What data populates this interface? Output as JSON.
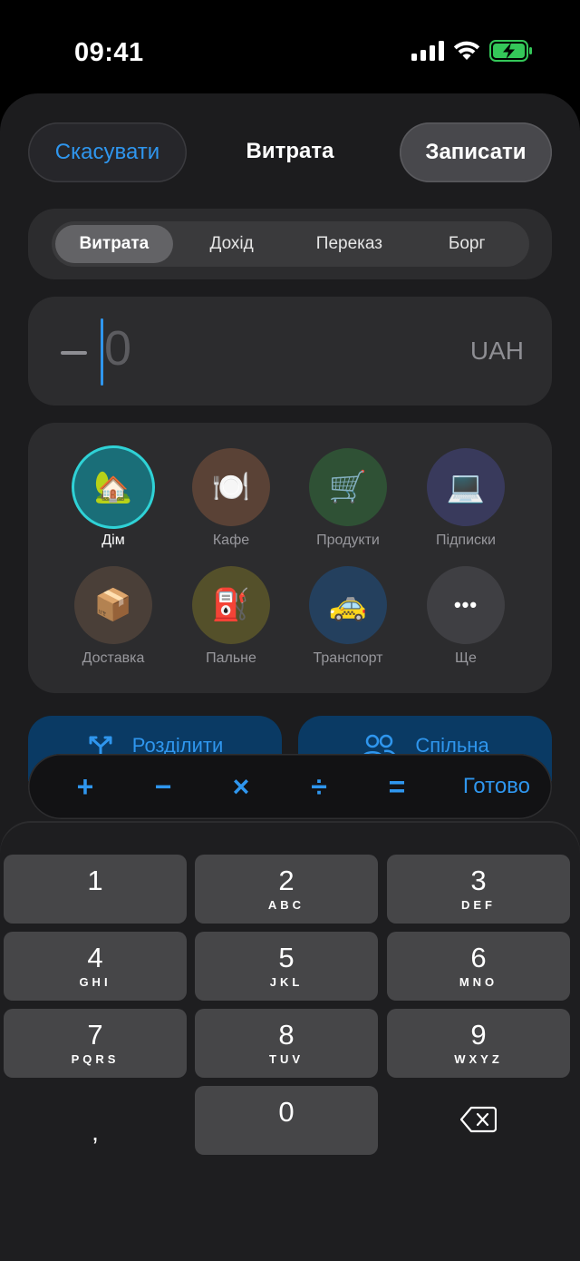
{
  "status": {
    "time": "09:41"
  },
  "nav": {
    "cancel": "Скасувати",
    "title": "Витрата",
    "save": "Записати"
  },
  "tabs": [
    "Витрата",
    "Дохід",
    "Переказ",
    "Борг"
  ],
  "amount": {
    "value": "0",
    "currency": "UAH"
  },
  "categories": [
    {
      "label": "Дім",
      "icon": "🏡",
      "icon_name": "house-icon",
      "color": "#1a6e78"
    },
    {
      "label": "Кафе",
      "icon": "🍽️",
      "icon_name": "plate-icon",
      "color": "#5a4236"
    },
    {
      "label": "Продукти",
      "icon": "🛒",
      "icon_name": "cart-icon",
      "color": "#2f5135"
    },
    {
      "label": "Підписки",
      "icon": "💻",
      "icon_name": "laptop-icon",
      "color": "#393a5c"
    },
    {
      "label": "Доставка",
      "icon": "📦",
      "icon_name": "package-icon",
      "color": "#4a3f38"
    },
    {
      "label": "Пальне",
      "icon": "⛽",
      "icon_name": "fuel-pump-icon",
      "color": "#54502a"
    },
    {
      "label": "Транспорт",
      "icon": "🚕",
      "icon_name": "taxi-icon",
      "color": "#24405e"
    },
    {
      "label": "Ще",
      "icon": "•••",
      "icon_name": "more-icon",
      "color": "#3f3f43"
    }
  ],
  "actions": {
    "split": "Розділити",
    "shared": "Спільна"
  },
  "calc": {
    "ops": [
      "+",
      "−",
      "×",
      "÷",
      "="
    ],
    "done": "Готово"
  },
  "keys": [
    {
      "digit": "1",
      "letters": ""
    },
    {
      "digit": "2",
      "letters": "ABC"
    },
    {
      "digit": "3",
      "letters": "DEF"
    },
    {
      "digit": "4",
      "letters": "GHI"
    },
    {
      "digit": "5",
      "letters": "JKL"
    },
    {
      "digit": "6",
      "letters": "MNO"
    },
    {
      "digit": "7",
      "letters": "PQRS"
    },
    {
      "digit": "8",
      "letters": "TUV"
    },
    {
      "digit": "9",
      "letters": "WXYZ"
    },
    {
      "digit": "0",
      "letters": ""
    }
  ],
  "comma": ",",
  "colors": {
    "accent": "#2f96ee",
    "selected_ring": "#2fd2d6",
    "battery": "#34c759"
  }
}
